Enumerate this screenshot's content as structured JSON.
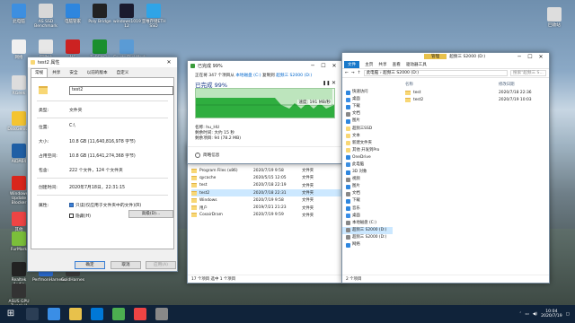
{
  "desktop": {
    "icons": [
      {
        "label": "此电脑",
        "color": "#3d8fe0"
      },
      {
        "label": "AS SSD Benchmark",
        "color": "#d8d8d8"
      },
      {
        "label": "电脑管家",
        "color": "#2e86de"
      },
      {
        "label": "Poly Bridge",
        "color": "#222"
      },
      {
        "label": "windows1019 12",
        "color": "#1a1a2e"
      },
      {
        "label": "亚唯存储ETH SSD",
        "color": "#2fa4e7"
      },
      {
        "label": "网络",
        "color": "#f0f0f0"
      },
      {
        "label": "回收站",
        "color": "#e7e7e7"
      },
      {
        "label": "ME",
        "color": "#c22"
      },
      {
        "label": "TxBENCH",
        "color": "#1a8f2e"
      },
      {
        "label": "CrystalDiskMark",
        "color": "#5a9bd5"
      },
      {
        "label": "RGeek",
        "color": "#ddd"
      },
      {
        "label": "DiskGenius",
        "color": "#f4c430"
      },
      {
        "label": "AIDA64",
        "color": "#1f5fa5"
      },
      {
        "label": "Windows Update Blocker",
        "color": "#d9261c"
      },
      {
        "label": "其他",
        "color": "#e44"
      },
      {
        "label": "FurMark",
        "color": "#7bbf3a"
      },
      {
        "label": "Realtek Audio",
        "color": "#222"
      },
      {
        "label": "PerfmonHarness",
        "color": "#2a6bd1"
      },
      {
        "label": "GoldHarnes",
        "color": "#3a3a3a"
      },
      {
        "label": "ASUS GPU Tweak II",
        "color": "#333"
      }
    ],
    "recycle": {
      "label": "回收站"
    }
  },
  "props": {
    "title": "test2 属性",
    "tabs": [
      "常规",
      "共享",
      "安全",
      "以前的版本",
      "自定义"
    ],
    "name": "test2",
    "rows": [
      {
        "lbl": "类型:",
        "val": "文件夹"
      },
      {
        "lbl": "位置:",
        "val": "C:\\"
      },
      {
        "lbl": "大小:",
        "val": "10.8 GB (11,640,816,978 字节)"
      },
      {
        "lbl": "占用空间:",
        "val": "10.8 GB (11,641,274,368 字节)"
      },
      {
        "lbl": "包含:",
        "val": "222 个文件，124 个文件夹"
      },
      {
        "lbl": "创建时间:",
        "val": "2020年7月18日，22:31:15"
      }
    ],
    "attr_label": "属性:",
    "readonly": "只读(仅应用于文件夹中的文件)(R)",
    "hidden": "隐藏(H)",
    "advanced": "高级(D)...",
    "ok": "确定",
    "cancel": "取消",
    "apply": "应用(A)"
  },
  "copy": {
    "title": "已完成 99%",
    "line1": "正在将 347 个项目从",
    "src": "本地磁盘 (C:)",
    "line1b": "复制到",
    "dst": "超频三 S2000 (D:)",
    "percent": "已完成 99%",
    "speed": "速度: 191 MB/秒",
    "progress": 0.99,
    "name_label": "名称: hu_HU",
    "time_left": "剩余时间: 大约 15 秒",
    "items_left": "剩余项目: 94 (78.2 MB)",
    "less": "简略信息"
  },
  "exp1": {
    "files": [
      {
        "name": "Program Files (x86)",
        "date": "2020/7/19 9:58",
        "type": "文件夹",
        "sel": false
      },
      {
        "name": "qycache",
        "date": "2020/5/15 12:05",
        "type": "文件夹",
        "sel": false
      },
      {
        "name": "test",
        "date": "2020/7/18 22:19",
        "type": "文件夹",
        "sel": false
      },
      {
        "name": "test2",
        "date": "2020/7/18 22:31",
        "type": "文件夹",
        "sel": true
      },
      {
        "name": "Windows",
        "date": "2020/7/19 9:58",
        "type": "文件夹",
        "sel": false
      },
      {
        "name": "用户",
        "date": "2019/7/21 21:23",
        "type": "文件夹",
        "sel": false
      },
      {
        "name": "CosairDram",
        "date": "2020/7/19 9:59",
        "type": "文件夹",
        "sel": false
      }
    ],
    "status": "17 个项目   选中 1 个项目"
  },
  "exp2": {
    "tabs": {
      "file": "文件",
      "home": "主页",
      "share": "共享",
      "view": "查看",
      "manage": "管理",
      "drive_tools": "驱动器工具"
    },
    "title": "超频三 S2000 (D:)",
    "path": "此电脑 › 超频三 S2000 (D:)",
    "search": "搜索\"超频三 S...",
    "col_name": "名称",
    "col_date": "修改日期",
    "files": [
      {
        "name": "test",
        "date": "2020/7/18 22:36"
      },
      {
        "name": "test2",
        "date": "2020/7/19 10:03"
      }
    ],
    "nav": [
      {
        "label": "快速访问",
        "c": "#2e86de",
        "sel": false
      },
      {
        "label": "桌面",
        "c": "#3a8ee6",
        "sel": false
      },
      {
        "label": "下载",
        "c": "#2e86de",
        "sel": false
      },
      {
        "label": "文档",
        "c": "#888",
        "sel": false
      },
      {
        "label": "图片",
        "c": "#2e86de",
        "sel": false
      },
      {
        "label": "超频三SSD",
        "c": "#f8d775",
        "sel": false
      },
      {
        "label": "文本",
        "c": "#f8d775",
        "sel": false
      },
      {
        "label": "新建文件夹",
        "c": "#f8d775",
        "sel": false
      },
      {
        "label": "其他 开发到Pro",
        "c": "#f8d775",
        "sel": false
      },
      {
        "label": "OneDrive",
        "c": "#2e86de",
        "sel": false
      },
      {
        "label": "此电脑",
        "c": "#3d8fe0",
        "sel": false
      },
      {
        "label": "3D 对象",
        "c": "#2e86de",
        "sel": false
      },
      {
        "label": "视频",
        "c": "#888",
        "sel": false
      },
      {
        "label": "图片",
        "c": "#2e86de",
        "sel": false
      },
      {
        "label": "文档",
        "c": "#888",
        "sel": false
      },
      {
        "label": "下载",
        "c": "#2e86de",
        "sel": false
      },
      {
        "label": "音乐",
        "c": "#2e86de",
        "sel": false
      },
      {
        "label": "桌面",
        "c": "#3a8ee6",
        "sel": false
      },
      {
        "label": "本地磁盘 (C:)",
        "c": "#888",
        "sel": false
      },
      {
        "label": "超频三 S2000 (D:)",
        "c": "#888",
        "sel": true
      },
      {
        "label": "超频三 S2000 (D:)",
        "c": "#888",
        "sel": false
      },
      {
        "label": "网络",
        "c": "#2e86de",
        "sel": false
      }
    ],
    "status": "2 个项目"
  },
  "taskbar": {
    "time": "10:04",
    "date": "2020/7/19"
  }
}
